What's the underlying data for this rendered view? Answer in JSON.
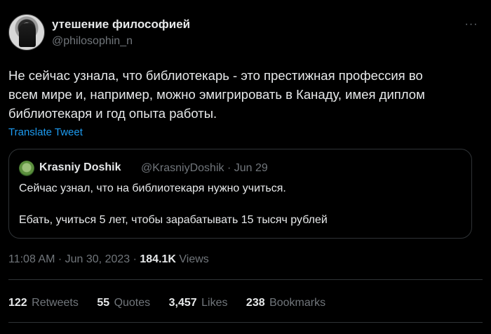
{
  "author": {
    "display_name": "утешение философией",
    "handle": "@philosophin_n",
    "more_label": "···"
  },
  "tweet": {
    "text": "Не сейчас узнала, что библиотекарь - это престижная профессия во\nвсем мире и, например, можно эмигрировать в Канаду, имея диплом\nбиблиотекаря и год опыта работы.",
    "translate_label": "Translate Tweet"
  },
  "quote": {
    "display_name": "Krasniy Doshik",
    "meta": "@KrasniyDoshik · Jun 29",
    "line1": "Сейчас узнал, что на библиотекаря нужно учиться.",
    "line2": "Ебать, учиться 5 лет, чтобы зарабатывать 15 тысяч рублей"
  },
  "timestamp": {
    "time_date": "11:08 AM · Jun 30, 2023 · ",
    "views_count": "184.1K",
    "views_label": " Views"
  },
  "stats": [
    {
      "count": "122",
      "label": "Retweets"
    },
    {
      "count": "55",
      "label": "Quotes"
    },
    {
      "count": "3,457",
      "label": "Likes"
    },
    {
      "count": "238",
      "label": "Bookmarks"
    }
  ],
  "colors": {
    "background": "#000000",
    "text": "#e7e9ea",
    "secondary": "#71767b",
    "link": "#1d9bf0",
    "border": "#2f3336"
  },
  "icons": [
    "avatar",
    "more-icon",
    "quote-avatar"
  ]
}
